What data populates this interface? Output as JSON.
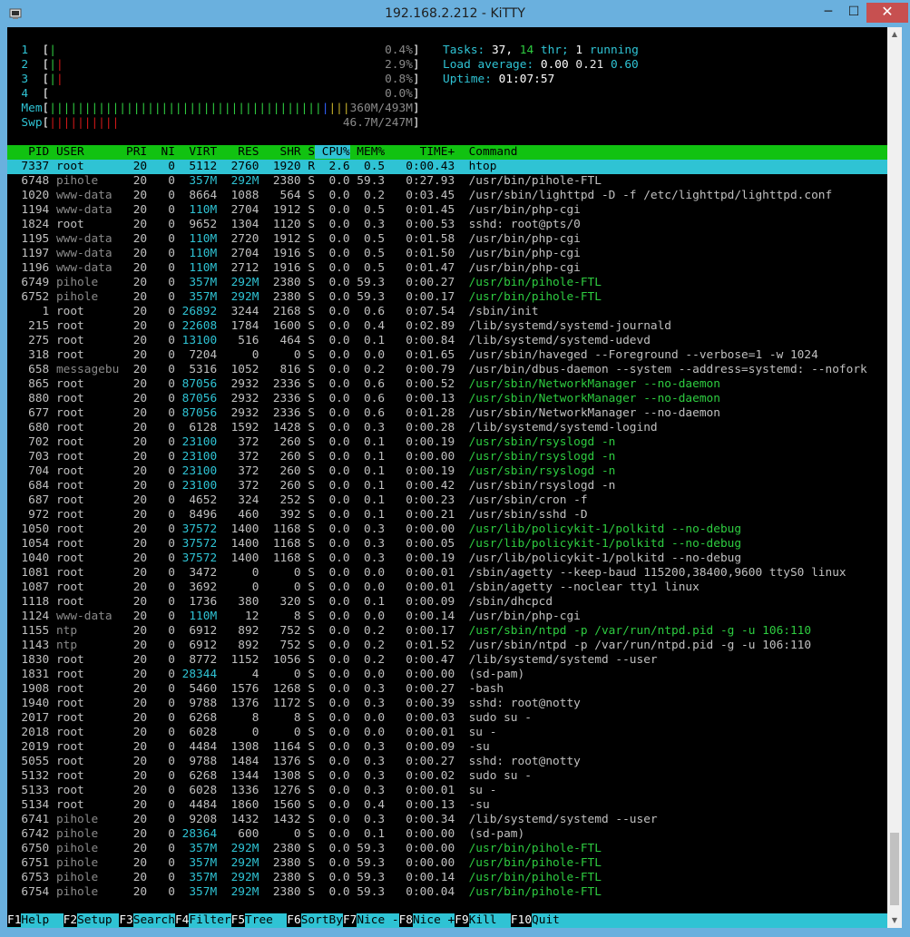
{
  "window": {
    "title": "192.168.2.212 - KiTTY",
    "min_label": "─",
    "max_label": "☐",
    "close_label": "✕"
  },
  "meters": {
    "cpus": [
      {
        "id": "1",
        "percent": "0.4%",
        "bar_green": "|",
        "bar_red": ""
      },
      {
        "id": "2",
        "percent": "2.9%",
        "bar_green": "|",
        "bar_red": "|"
      },
      {
        "id": "3",
        "percent": "0.8%",
        "bar_green": "|",
        "bar_red": "|"
      },
      {
        "id": "4",
        "percent": "0.0%",
        "bar_green": "",
        "bar_red": ""
      }
    ],
    "mem": {
      "label": "Mem",
      "value": "360M/493M"
    },
    "swp": {
      "label": "Swp",
      "value": "46.7M/247M"
    },
    "tasks_label": "Tasks:",
    "tasks_value": "37,",
    "thr_value": "14",
    "thr_label": "thr;",
    "running_value": "1",
    "running_label": "running",
    "load_label": "Load average:",
    "load1": "0.00",
    "load5": "0.21",
    "load15": "0.60",
    "uptime_label": "Uptime:",
    "uptime_value": "01:07:57"
  },
  "columns": [
    "PID",
    "USER",
    "PRI",
    "NI",
    "VIRT",
    "RES",
    "SHR",
    "S",
    "CPU%",
    "MEM%",
    "TIME+",
    "Command"
  ],
  "processes": [
    {
      "pid": "7337",
      "user": "root",
      "pri": "20",
      "ni": "0",
      "virt": "5112",
      "res": "2760",
      "shr": "1920",
      "s": "R",
      "cpu": "2.6",
      "mem": "0.5",
      "time": "0:00.43",
      "cmd": "htop",
      "selected": true
    },
    {
      "pid": "6748",
      "user": "pihole",
      "pri": "20",
      "ni": "0",
      "virt": "357M",
      "res": "292M",
      "shr": "2380",
      "s": "S",
      "cpu": "0.0",
      "mem": "59.3",
      "time": "0:27.93",
      "cmd": "/usr/bin/pihole-FTL"
    },
    {
      "pid": "1020",
      "user": "www-data",
      "pri": "20",
      "ni": "0",
      "virt": "8664",
      "res": "1088",
      "shr": "564",
      "s": "S",
      "cpu": "0.0",
      "mem": "0.2",
      "time": "0:03.45",
      "cmd": "/usr/sbin/lighttpd -D -f /etc/lighttpd/lighttpd.conf"
    },
    {
      "pid": "1194",
      "user": "www-data",
      "pri": "20",
      "ni": "0",
      "virt": "110M",
      "res": "2704",
      "shr": "1912",
      "s": "S",
      "cpu": "0.0",
      "mem": "0.5",
      "time": "0:01.45",
      "cmd": "/usr/bin/php-cgi"
    },
    {
      "pid": "1824",
      "user": "root",
      "pri": "20",
      "ni": "0",
      "virt": "9652",
      "res": "1304",
      "shr": "1120",
      "s": "S",
      "cpu": "0.0",
      "mem": "0.3",
      "time": "0:00.53",
      "cmd": "sshd: root@pts/0"
    },
    {
      "pid": "1195",
      "user": "www-data",
      "pri": "20",
      "ni": "0",
      "virt": "110M",
      "res": "2720",
      "shr": "1912",
      "s": "S",
      "cpu": "0.0",
      "mem": "0.5",
      "time": "0:01.58",
      "cmd": "/usr/bin/php-cgi"
    },
    {
      "pid": "1197",
      "user": "www-data",
      "pri": "20",
      "ni": "0",
      "virt": "110M",
      "res": "2704",
      "shr": "1916",
      "s": "S",
      "cpu": "0.0",
      "mem": "0.5",
      "time": "0:01.50",
      "cmd": "/usr/bin/php-cgi"
    },
    {
      "pid": "1196",
      "user": "www-data",
      "pri": "20",
      "ni": "0",
      "virt": "110M",
      "res": "2712",
      "shr": "1916",
      "s": "S",
      "cpu": "0.0",
      "mem": "0.5",
      "time": "0:01.47",
      "cmd": "/usr/bin/php-cgi"
    },
    {
      "pid": "6749",
      "user": "pihole",
      "pri": "20",
      "ni": "0",
      "virt": "357M",
      "res": "292M",
      "shr": "2380",
      "s": "S",
      "cpu": "0.0",
      "mem": "59.3",
      "time": "0:00.27",
      "cmd": "/usr/bin/pihole-FTL",
      "thread": true
    },
    {
      "pid": "6752",
      "user": "pihole",
      "pri": "20",
      "ni": "0",
      "virt": "357M",
      "res": "292M",
      "shr": "2380",
      "s": "S",
      "cpu": "0.0",
      "mem": "59.3",
      "time": "0:00.17",
      "cmd": "/usr/bin/pihole-FTL",
      "thread": true
    },
    {
      "pid": "1",
      "user": "root",
      "pri": "20",
      "ni": "0",
      "virt": "26892",
      "res": "3244",
      "shr": "2168",
      "s": "S",
      "cpu": "0.0",
      "mem": "0.6",
      "time": "0:07.54",
      "cmd": "/sbin/init"
    },
    {
      "pid": "215",
      "user": "root",
      "pri": "20",
      "ni": "0",
      "virt": "22608",
      "res": "1784",
      "shr": "1600",
      "s": "S",
      "cpu": "0.0",
      "mem": "0.4",
      "time": "0:02.89",
      "cmd": "/lib/systemd/systemd-journald"
    },
    {
      "pid": "275",
      "user": "root",
      "pri": "20",
      "ni": "0",
      "virt": "13100",
      "res": "516",
      "shr": "464",
      "s": "S",
      "cpu": "0.0",
      "mem": "0.1",
      "time": "0:00.84",
      "cmd": "/lib/systemd/systemd-udevd"
    },
    {
      "pid": "318",
      "user": "root",
      "pri": "20",
      "ni": "0",
      "virt": "7204",
      "res": "0",
      "shr": "0",
      "s": "S",
      "cpu": "0.0",
      "mem": "0.0",
      "time": "0:01.65",
      "cmd": "/usr/sbin/haveged --Foreground --verbose=1 -w 1024"
    },
    {
      "pid": "658",
      "user": "messagebu",
      "pri": "20",
      "ni": "0",
      "virt": "5316",
      "res": "1052",
      "shr": "816",
      "s": "S",
      "cpu": "0.0",
      "mem": "0.2",
      "time": "0:00.79",
      "cmd": "/usr/bin/dbus-daemon --system --address=systemd: --nofork"
    },
    {
      "pid": "865",
      "user": "root",
      "pri": "20",
      "ni": "0",
      "virt": "87056",
      "res": "2932",
      "shr": "2336",
      "s": "S",
      "cpu": "0.0",
      "mem": "0.6",
      "time": "0:00.52",
      "cmd": "/usr/sbin/NetworkManager --no-daemon",
      "thread": true
    },
    {
      "pid": "880",
      "user": "root",
      "pri": "20",
      "ni": "0",
      "virt": "87056",
      "res": "2932",
      "shr": "2336",
      "s": "S",
      "cpu": "0.0",
      "mem": "0.6",
      "time": "0:00.13",
      "cmd": "/usr/sbin/NetworkManager --no-daemon",
      "thread": true
    },
    {
      "pid": "677",
      "user": "root",
      "pri": "20",
      "ni": "0",
      "virt": "87056",
      "res": "2932",
      "shr": "2336",
      "s": "S",
      "cpu": "0.0",
      "mem": "0.6",
      "time": "0:01.28",
      "cmd": "/usr/sbin/NetworkManager --no-daemon"
    },
    {
      "pid": "680",
      "user": "root",
      "pri": "20",
      "ni": "0",
      "virt": "6128",
      "res": "1592",
      "shr": "1428",
      "s": "S",
      "cpu": "0.0",
      "mem": "0.3",
      "time": "0:00.28",
      "cmd": "/lib/systemd/systemd-logind"
    },
    {
      "pid": "702",
      "user": "root",
      "pri": "20",
      "ni": "0",
      "virt": "23100",
      "res": "372",
      "shr": "260",
      "s": "S",
      "cpu": "0.0",
      "mem": "0.1",
      "time": "0:00.19",
      "cmd": "/usr/sbin/rsyslogd -n",
      "thread": true
    },
    {
      "pid": "703",
      "user": "root",
      "pri": "20",
      "ni": "0",
      "virt": "23100",
      "res": "372",
      "shr": "260",
      "s": "S",
      "cpu": "0.0",
      "mem": "0.1",
      "time": "0:00.00",
      "cmd": "/usr/sbin/rsyslogd -n",
      "thread": true
    },
    {
      "pid": "704",
      "user": "root",
      "pri": "20",
      "ni": "0",
      "virt": "23100",
      "res": "372",
      "shr": "260",
      "s": "S",
      "cpu": "0.0",
      "mem": "0.1",
      "time": "0:00.19",
      "cmd": "/usr/sbin/rsyslogd -n",
      "thread": true
    },
    {
      "pid": "684",
      "user": "root",
      "pri": "20",
      "ni": "0",
      "virt": "23100",
      "res": "372",
      "shr": "260",
      "s": "S",
      "cpu": "0.0",
      "mem": "0.1",
      "time": "0:00.42",
      "cmd": "/usr/sbin/rsyslogd -n"
    },
    {
      "pid": "687",
      "user": "root",
      "pri": "20",
      "ni": "0",
      "virt": "4652",
      "res": "324",
      "shr": "252",
      "s": "S",
      "cpu": "0.0",
      "mem": "0.1",
      "time": "0:00.23",
      "cmd": "/usr/sbin/cron -f"
    },
    {
      "pid": "972",
      "user": "root",
      "pri": "20",
      "ni": "0",
      "virt": "8496",
      "res": "460",
      "shr": "392",
      "s": "S",
      "cpu": "0.0",
      "mem": "0.1",
      "time": "0:00.21",
      "cmd": "/usr/sbin/sshd -D"
    },
    {
      "pid": "1050",
      "user": "root",
      "pri": "20",
      "ni": "0",
      "virt": "37572",
      "res": "1400",
      "shr": "1168",
      "s": "S",
      "cpu": "0.0",
      "mem": "0.3",
      "time": "0:00.00",
      "cmd": "/usr/lib/policykit-1/polkitd --no-debug",
      "thread": true
    },
    {
      "pid": "1054",
      "user": "root",
      "pri": "20",
      "ni": "0",
      "virt": "37572",
      "res": "1400",
      "shr": "1168",
      "s": "S",
      "cpu": "0.0",
      "mem": "0.3",
      "time": "0:00.05",
      "cmd": "/usr/lib/policykit-1/polkitd --no-debug",
      "thread": true
    },
    {
      "pid": "1040",
      "user": "root",
      "pri": "20",
      "ni": "0",
      "virt": "37572",
      "res": "1400",
      "shr": "1168",
      "s": "S",
      "cpu": "0.0",
      "mem": "0.3",
      "time": "0:00.19",
      "cmd": "/usr/lib/policykit-1/polkitd --no-debug"
    },
    {
      "pid": "1081",
      "user": "root",
      "pri": "20",
      "ni": "0",
      "virt": "3472",
      "res": "0",
      "shr": "0",
      "s": "S",
      "cpu": "0.0",
      "mem": "0.0",
      "time": "0:00.01",
      "cmd": "/sbin/agetty --keep-baud 115200,38400,9600 ttyS0 linux"
    },
    {
      "pid": "1087",
      "user": "root",
      "pri": "20",
      "ni": "0",
      "virt": "3692",
      "res": "0",
      "shr": "0",
      "s": "S",
      "cpu": "0.0",
      "mem": "0.0",
      "time": "0:00.01",
      "cmd": "/sbin/agetty --noclear tty1 linux"
    },
    {
      "pid": "1118",
      "user": "root",
      "pri": "20",
      "ni": "0",
      "virt": "1736",
      "res": "380",
      "shr": "320",
      "s": "S",
      "cpu": "0.0",
      "mem": "0.1",
      "time": "0:00.09",
      "cmd": "/sbin/dhcpcd"
    },
    {
      "pid": "1124",
      "user": "www-data",
      "pri": "20",
      "ni": "0",
      "virt": "110M",
      "res": "12",
      "shr": "8",
      "s": "S",
      "cpu": "0.0",
      "mem": "0.0",
      "time": "0:00.14",
      "cmd": "/usr/bin/php-cgi"
    },
    {
      "pid": "1155",
      "user": "ntp",
      "pri": "20",
      "ni": "0",
      "virt": "6912",
      "res": "892",
      "shr": "752",
      "s": "S",
      "cpu": "0.0",
      "mem": "0.2",
      "time": "0:00.17",
      "cmd": "/usr/sbin/ntpd -p /var/run/ntpd.pid -g -u 106:110",
      "thread": true
    },
    {
      "pid": "1143",
      "user": "ntp",
      "pri": "20",
      "ni": "0",
      "virt": "6912",
      "res": "892",
      "shr": "752",
      "s": "S",
      "cpu": "0.0",
      "mem": "0.2",
      "time": "0:01.52",
      "cmd": "/usr/sbin/ntpd -p /var/run/ntpd.pid -g -u 106:110"
    },
    {
      "pid": "1830",
      "user": "root",
      "pri": "20",
      "ni": "0",
      "virt": "8772",
      "res": "1152",
      "shr": "1056",
      "s": "S",
      "cpu": "0.0",
      "mem": "0.2",
      "time": "0:00.47",
      "cmd": "/lib/systemd/systemd --user"
    },
    {
      "pid": "1831",
      "user": "root",
      "pri": "20",
      "ni": "0",
      "virt": "28344",
      "res": "4",
      "shr": "0",
      "s": "S",
      "cpu": "0.0",
      "mem": "0.0",
      "time": "0:00.00",
      "cmd": "(sd-pam)"
    },
    {
      "pid": "1908",
      "user": "root",
      "pri": "20",
      "ni": "0",
      "virt": "5460",
      "res": "1576",
      "shr": "1268",
      "s": "S",
      "cpu": "0.0",
      "mem": "0.3",
      "time": "0:00.27",
      "cmd": "-bash"
    },
    {
      "pid": "1940",
      "user": "root",
      "pri": "20",
      "ni": "0",
      "virt": "9788",
      "res": "1376",
      "shr": "1172",
      "s": "S",
      "cpu": "0.0",
      "mem": "0.3",
      "time": "0:00.39",
      "cmd": "sshd: root@notty"
    },
    {
      "pid": "2017",
      "user": "root",
      "pri": "20",
      "ni": "0",
      "virt": "6268",
      "res": "8",
      "shr": "8",
      "s": "S",
      "cpu": "0.0",
      "mem": "0.0",
      "time": "0:00.03",
      "cmd": "sudo su -"
    },
    {
      "pid": "2018",
      "user": "root",
      "pri": "20",
      "ni": "0",
      "virt": "6028",
      "res": "0",
      "shr": "0",
      "s": "S",
      "cpu": "0.0",
      "mem": "0.0",
      "time": "0:00.01",
      "cmd": "su -"
    },
    {
      "pid": "2019",
      "user": "root",
      "pri": "20",
      "ni": "0",
      "virt": "4484",
      "res": "1308",
      "shr": "1164",
      "s": "S",
      "cpu": "0.0",
      "mem": "0.3",
      "time": "0:00.09",
      "cmd": "-su"
    },
    {
      "pid": "5055",
      "user": "root",
      "pri": "20",
      "ni": "0",
      "virt": "9788",
      "res": "1484",
      "shr": "1376",
      "s": "S",
      "cpu": "0.0",
      "mem": "0.3",
      "time": "0:00.27",
      "cmd": "sshd: root@notty"
    },
    {
      "pid": "5132",
      "user": "root",
      "pri": "20",
      "ni": "0",
      "virt": "6268",
      "res": "1344",
      "shr": "1308",
      "s": "S",
      "cpu": "0.0",
      "mem": "0.3",
      "time": "0:00.02",
      "cmd": "sudo su -"
    },
    {
      "pid": "5133",
      "user": "root",
      "pri": "20",
      "ni": "0",
      "virt": "6028",
      "res": "1336",
      "shr": "1276",
      "s": "S",
      "cpu": "0.0",
      "mem": "0.3",
      "time": "0:00.01",
      "cmd": "su -"
    },
    {
      "pid": "5134",
      "user": "root",
      "pri": "20",
      "ni": "0",
      "virt": "4484",
      "res": "1860",
      "shr": "1560",
      "s": "S",
      "cpu": "0.0",
      "mem": "0.4",
      "time": "0:00.13",
      "cmd": "-su"
    },
    {
      "pid": "6741",
      "user": "pihole",
      "pri": "20",
      "ni": "0",
      "virt": "9208",
      "res": "1432",
      "shr": "1432",
      "s": "S",
      "cpu": "0.0",
      "mem": "0.3",
      "time": "0:00.34",
      "cmd": "/lib/systemd/systemd --user"
    },
    {
      "pid": "6742",
      "user": "pihole",
      "pri": "20",
      "ni": "0",
      "virt": "28364",
      "res": "600",
      "shr": "0",
      "s": "S",
      "cpu": "0.0",
      "mem": "0.1",
      "time": "0:00.00",
      "cmd": "(sd-pam)"
    },
    {
      "pid": "6750",
      "user": "pihole",
      "pri": "20",
      "ni": "0",
      "virt": "357M",
      "res": "292M",
      "shr": "2380",
      "s": "S",
      "cpu": "0.0",
      "mem": "59.3",
      "time": "0:00.00",
      "cmd": "/usr/bin/pihole-FTL",
      "thread": true
    },
    {
      "pid": "6751",
      "user": "pihole",
      "pri": "20",
      "ni": "0",
      "virt": "357M",
      "res": "292M",
      "shr": "2380",
      "s": "S",
      "cpu": "0.0",
      "mem": "59.3",
      "time": "0:00.00",
      "cmd": "/usr/bin/pihole-FTL",
      "thread": true
    },
    {
      "pid": "6753",
      "user": "pihole",
      "pri": "20",
      "ni": "0",
      "virt": "357M",
      "res": "292M",
      "shr": "2380",
      "s": "S",
      "cpu": "0.0",
      "mem": "59.3",
      "time": "0:00.14",
      "cmd": "/usr/bin/pihole-FTL",
      "thread": true
    },
    {
      "pid": "6754",
      "user": "pihole",
      "pri": "20",
      "ni": "0",
      "virt": "357M",
      "res": "292M",
      "shr": "2380",
      "s": "S",
      "cpu": "0.0",
      "mem": "59.3",
      "time": "0:00.04",
      "cmd": "/usr/bin/pihole-FTL",
      "thread": true
    }
  ],
  "fkeys": [
    {
      "key": "F1",
      "label": "Help  "
    },
    {
      "key": "F2",
      "label": "Setup "
    },
    {
      "key": "F3",
      "label": "Search"
    },
    {
      "key": "F4",
      "label": "Filter"
    },
    {
      "key": "F5",
      "label": "Tree  "
    },
    {
      "key": "F6",
      "label": "SortBy"
    },
    {
      "key": "F7",
      "label": "Nice -"
    },
    {
      "key": "F8",
      "label": "Nice +"
    },
    {
      "key": "F9",
      "label": "Kill  "
    },
    {
      "key": "F10",
      "label": "Quit  "
    }
  ],
  "colors": {
    "header_bg": "#11c211",
    "selection_bg": "#2fc3d4",
    "terminal_bg": "#000000",
    "titlebar_bg": "#6ab0de"
  }
}
